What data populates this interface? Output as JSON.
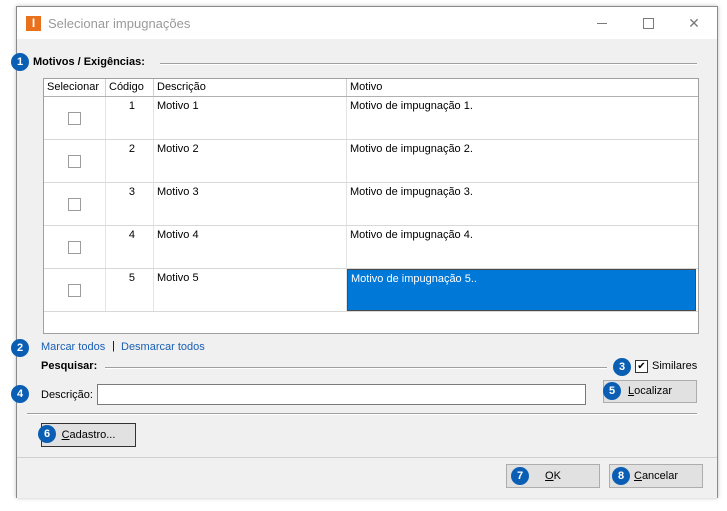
{
  "window": {
    "title": "Selecionar impugnações",
    "app_icon_letter": "I"
  },
  "markers": [
    "1",
    "2",
    "3",
    "4",
    "5",
    "6",
    "7",
    "8"
  ],
  "section": {
    "title": "Motivos / Exigências:"
  },
  "grid": {
    "headers": [
      "Selecionar",
      "Código",
      "Descrição",
      "Motivo"
    ],
    "rows": [
      {
        "codigo": "1",
        "descricao": "Motivo 1",
        "motivo": "Motivo de impugnação 1.",
        "checked": false
      },
      {
        "codigo": "2",
        "descricao": "Motivo 2",
        "motivo": "Motivo de impugnação 2.",
        "checked": false
      },
      {
        "codigo": "3",
        "descricao": "Motivo 3",
        "motivo": "Motivo de impugnação 3.",
        "checked": false
      },
      {
        "codigo": "4",
        "descricao": "Motivo 4",
        "motivo": "Motivo de impugnação 4.",
        "checked": false
      },
      {
        "codigo": "5",
        "descricao": "Motivo 5",
        "motivo": "Motivo de impugnação 5..",
        "checked": false
      }
    ],
    "selected_row": 5
  },
  "links": {
    "mark_all": "Marcar todos",
    "separator": "|",
    "unmark_all": "Desmarcar todos"
  },
  "search": {
    "title": "Pesquisar:",
    "similares_label": "Similares",
    "similares_checked": true,
    "descricao_label": "Descrição:",
    "descricao_value": "",
    "localizar": {
      "pre": "",
      "key": "L",
      "post": "ocalizar"
    }
  },
  "cadastro": {
    "pre": "",
    "key": "C",
    "post": "adastro..."
  },
  "ok": {
    "pre": "",
    "key": "O",
    "post": "K"
  },
  "cancelar": {
    "pre": "",
    "key": "C",
    "post": "ancelar"
  },
  "colors": {
    "accent": "#0a5fb4",
    "selection": "#0078d7",
    "icon": "#e9711c"
  }
}
